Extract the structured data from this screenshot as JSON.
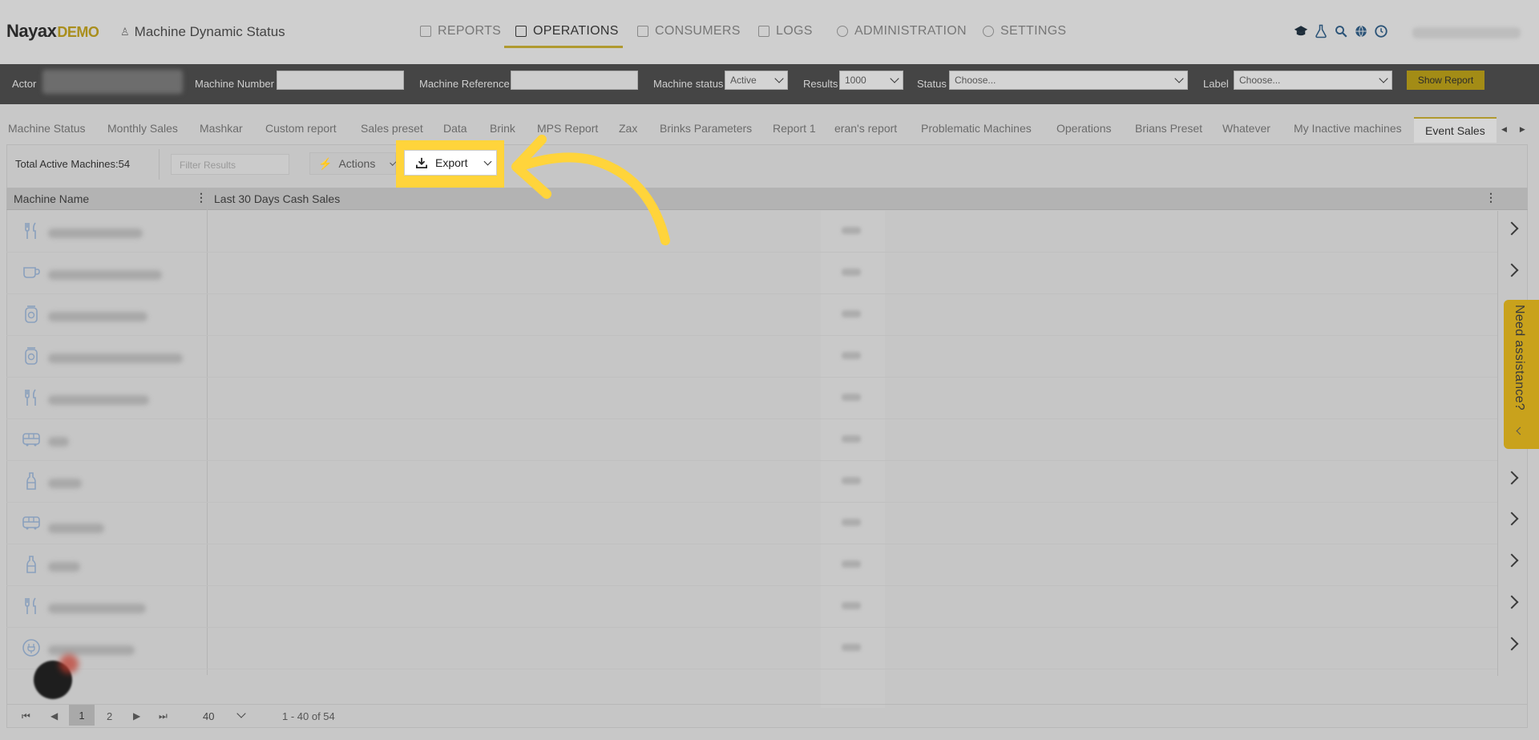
{
  "brand": {
    "name": "Nayax",
    "suffix": "DEMO"
  },
  "page_title": "Machine Dynamic Status",
  "nav": [
    {
      "label": "REPORTS",
      "active": false
    },
    {
      "label": "OPERATIONS",
      "active": true
    },
    {
      "label": "CONSUMERS",
      "active": false
    },
    {
      "label": "LOGS",
      "active": false
    },
    {
      "label": "ADMINISTRATION",
      "active": false
    },
    {
      "label": "SETTINGS",
      "active": false
    }
  ],
  "header_icons": [
    "graduation-cap-icon",
    "flask-icon",
    "search-icon",
    "globe-icon",
    "clock-icon"
  ],
  "filters": {
    "actor_label": "Actor",
    "machine_number_label": "Machine Number",
    "machine_reference_label": "Machine Reference",
    "machine_status_label": "Machine status",
    "machine_status_value": "Active",
    "results_label": "Results",
    "results_value": "1000",
    "status_label": "Status",
    "status_placeholder": "Choose...",
    "label_label": "Label",
    "label_placeholder": "Choose...",
    "show_report": "Show Report"
  },
  "tabs": [
    "Machine Status",
    "Monthly Sales",
    "Mashkar",
    "Custom report",
    "Sales preset",
    "Data",
    "Brink",
    "MPS Report",
    "Zax",
    "Brinks Parameters",
    "Report 1",
    "eran's report",
    "Problematic Machines",
    "Operations",
    "Brians Preset",
    "Whatever",
    "My Inactive machines",
    "Event Sales"
  ],
  "active_tab": "Event Sales",
  "toolbar": {
    "total": "Total Active Machines:54",
    "filter_placeholder": "Filter Results",
    "actions": "Actions",
    "export": "Export"
  },
  "columns": [
    "Machine Name",
    "Last 30 Days Cash Sales"
  ],
  "row_icons": [
    "fork-knife-icon",
    "coffee-cup-icon",
    "jar-icon",
    "jar-icon",
    "fork-knife-icon",
    "bus-icon",
    "bottle-icon",
    "bus-icon",
    "bottle-icon",
    "fork-knife-icon",
    "power-plug-icon"
  ],
  "pager": {
    "current": "1",
    "next_page": "2",
    "page_size": "40",
    "range": "1 - 40 of 54"
  },
  "assistance": "Need assistance?",
  "colors": {
    "accent": "#b09a30",
    "highlight": "#ffd43b",
    "button": "#a38c16"
  }
}
